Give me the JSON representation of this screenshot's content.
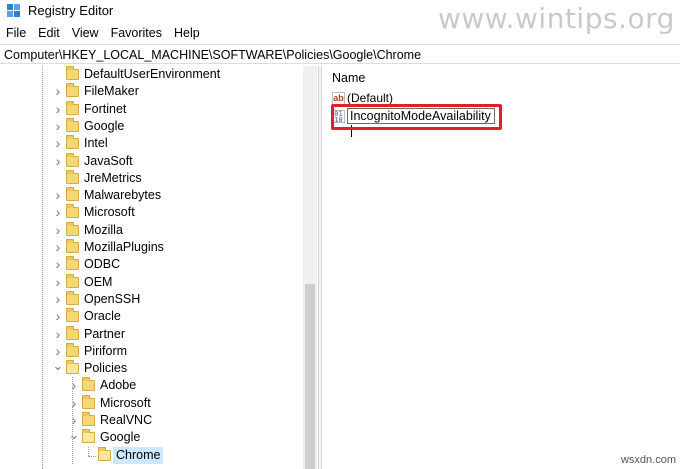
{
  "window": {
    "title": "Registry Editor",
    "watermark": "www.wintips.org"
  },
  "menu": [
    "File",
    "Edit",
    "View",
    "Favorites",
    "Help"
  ],
  "address": "Computer\\HKEY_LOCAL_MACHINE\\SOFTWARE\\Policies\\Google\\Chrome",
  "tree": {
    "items": [
      {
        "label": "DefaultUserEnvironment",
        "depth": 0,
        "expander": "none",
        "open": false
      },
      {
        "label": "FileMaker",
        "depth": 0,
        "expander": "collapsed",
        "open": false
      },
      {
        "label": "Fortinet",
        "depth": 0,
        "expander": "collapsed",
        "open": false
      },
      {
        "label": "Google",
        "depth": 0,
        "expander": "collapsed",
        "open": false
      },
      {
        "label": "Intel",
        "depth": 0,
        "expander": "collapsed",
        "open": false
      },
      {
        "label": "JavaSoft",
        "depth": 0,
        "expander": "collapsed",
        "open": false
      },
      {
        "label": "JreMetrics",
        "depth": 0,
        "expander": "none",
        "open": false
      },
      {
        "label": "Malwarebytes",
        "depth": 0,
        "expander": "collapsed",
        "open": false
      },
      {
        "label": "Microsoft",
        "depth": 0,
        "expander": "collapsed",
        "open": false
      },
      {
        "label": "Mozilla",
        "depth": 0,
        "expander": "collapsed",
        "open": false
      },
      {
        "label": "MozillaPlugins",
        "depth": 0,
        "expander": "collapsed",
        "open": false
      },
      {
        "label": "ODBC",
        "depth": 0,
        "expander": "collapsed",
        "open": false
      },
      {
        "label": "OEM",
        "depth": 0,
        "expander": "collapsed",
        "open": false
      },
      {
        "label": "OpenSSH",
        "depth": 0,
        "expander": "collapsed",
        "open": false
      },
      {
        "label": "Oracle",
        "depth": 0,
        "expander": "collapsed",
        "open": false
      },
      {
        "label": "Partner",
        "depth": 0,
        "expander": "collapsed",
        "open": false
      },
      {
        "label": "Piriform",
        "depth": 0,
        "expander": "collapsed",
        "open": false
      },
      {
        "label": "Policies",
        "depth": 0,
        "expander": "expanded",
        "open": true
      },
      {
        "label": "Adobe",
        "depth": 1,
        "expander": "collapsed",
        "open": false
      },
      {
        "label": "Microsoft",
        "depth": 1,
        "expander": "collapsed",
        "open": false
      },
      {
        "label": "RealVNC",
        "depth": 1,
        "expander": "collapsed",
        "open": false
      },
      {
        "label": "Google",
        "depth": 1,
        "expander": "expanded",
        "open": true
      },
      {
        "label": "Chrome",
        "depth": 2,
        "expander": "none",
        "open": false,
        "selected": true
      }
    ]
  },
  "values": {
    "column_name": "Name",
    "default_label": "(Default)",
    "editing_value": "IncognitoModeAvailability"
  },
  "credit": "wsxdn.com",
  "colors": {
    "highlight": "#e01f26",
    "selection": "#cce8ff",
    "folder": "#f7d675"
  }
}
